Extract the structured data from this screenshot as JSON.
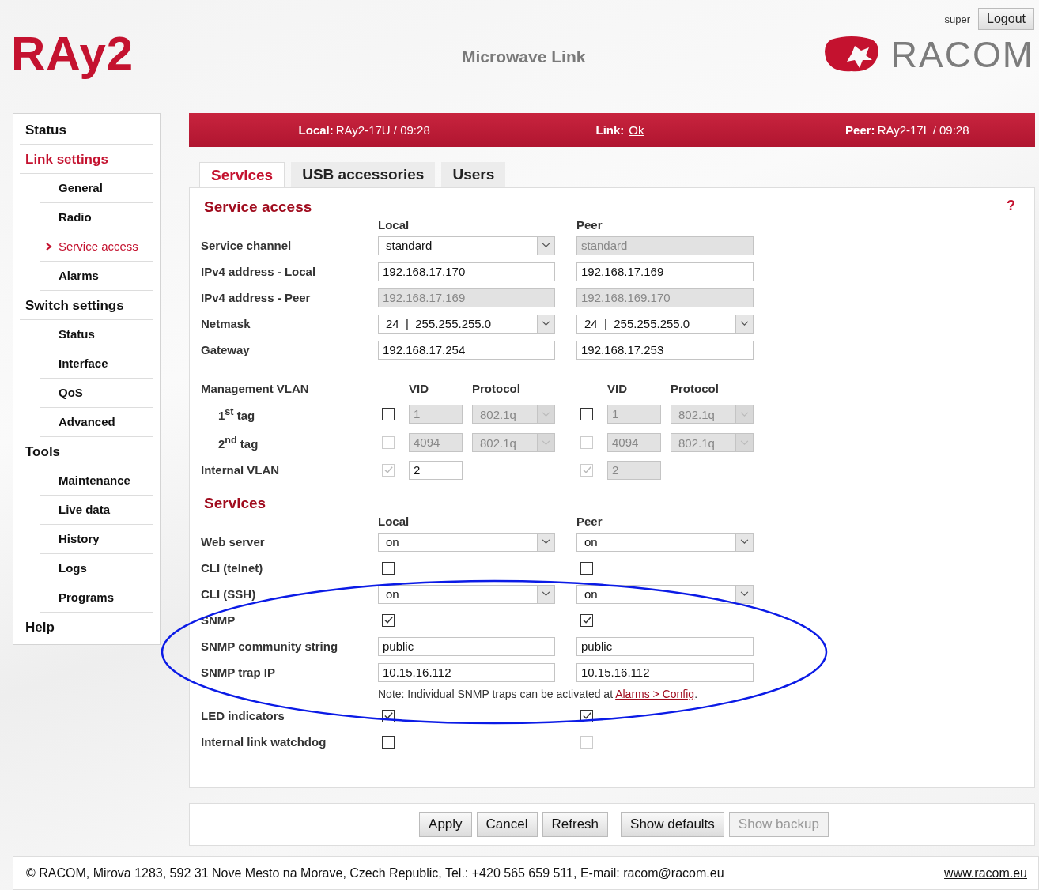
{
  "header": {
    "logo": "RAy2",
    "title": "Microwave Link",
    "brand": "RACOM",
    "user": "super",
    "logout": "Logout"
  },
  "sidebar": [
    {
      "label": "Status",
      "selected": false
    },
    {
      "label": "Link settings",
      "selected": true,
      "children": [
        {
          "label": "General",
          "selected": false
        },
        {
          "label": "Radio",
          "selected": false
        },
        {
          "label": "Service access",
          "selected": true
        },
        {
          "label": "Alarms",
          "selected": false
        }
      ]
    },
    {
      "label": "Switch settings",
      "selected": false,
      "children": [
        {
          "label": "Status",
          "selected": false
        },
        {
          "label": "Interface",
          "selected": false
        },
        {
          "label": "QoS",
          "selected": false
        },
        {
          "label": "Advanced",
          "selected": false
        }
      ]
    },
    {
      "label": "Tools",
      "selected": false,
      "children": [
        {
          "label": "Maintenance",
          "selected": false
        },
        {
          "label": "Live data",
          "selected": false
        },
        {
          "label": "History",
          "selected": false
        },
        {
          "label": "Logs",
          "selected": false
        },
        {
          "label": "Programs",
          "selected": false
        }
      ]
    },
    {
      "label": "Help",
      "selected": false
    }
  ],
  "status_bar": [
    {
      "label": "Local:",
      "value": "RAy2-17U / 09:28",
      "kind": "text"
    },
    {
      "label": "Link:",
      "value": "Ok",
      "kind": "link"
    },
    {
      "label": "Peer:",
      "value": "RAy2-17L / 09:28",
      "kind": "text"
    }
  ],
  "tabs": [
    {
      "label": "Services",
      "selected": true
    },
    {
      "label": "USB accessories",
      "selected": false
    },
    {
      "label": "Users",
      "selected": false
    }
  ],
  "help": "?",
  "sections": [
    {
      "title": "Service access",
      "columns": [
        "Local",
        "Peer"
      ],
      "rows": [
        {
          "kind": "field",
          "label": "Service channel",
          "local": [
            {
              "kind": "select",
              "value": "standard",
              "disabled": false
            }
          ],
          "peer": [
            {
              "kind": "input",
              "value": "standard",
              "disabled": true
            }
          ]
        },
        {
          "kind": "field",
          "label": "IPv4 address - Local",
          "local": [
            {
              "kind": "input",
              "value": "192.168.17.170",
              "disabled": false
            }
          ],
          "peer": [
            {
              "kind": "input",
              "value": "192.168.17.169",
              "disabled": false
            }
          ]
        },
        {
          "kind": "field",
          "label": "IPv4 address - Peer",
          "local": [
            {
              "kind": "input",
              "value": "192.168.17.169",
              "disabled": true
            }
          ],
          "peer": [
            {
              "kind": "input",
              "value": "192.168.169.170",
              "disabled": true
            }
          ]
        },
        {
          "kind": "field",
          "label": "Netmask",
          "local": [
            {
              "kind": "select",
              "value": "24  |  255.255.255.0",
              "disabled": false
            }
          ],
          "peer": [
            {
              "kind": "select",
              "value": "24  |  255.255.255.0",
              "disabled": false
            }
          ]
        },
        {
          "kind": "field",
          "label": "Gateway",
          "local": [
            {
              "kind": "input",
              "value": "192.168.17.254",
              "disabled": false
            }
          ],
          "peer": [
            {
              "kind": "input",
              "value": "192.168.17.253",
              "disabled": false
            }
          ]
        },
        {
          "kind": "header",
          "label": "Management VLAN",
          "local": [
            "VID",
            "Protocol"
          ],
          "peer": [
            "VID",
            "Protocol"
          ]
        },
        {
          "kind": "sub",
          "label": "1$^{st}$ tag",
          "local": [
            {
              "kind": "checkbox",
              "checked": false,
              "disabled": false
            },
            {
              "kind": "vid",
              "value": "1",
              "disabled": true
            },
            {
              "kind": "protocol",
              "value": "802.1q",
              "disabled": true
            }
          ],
          "peer": [
            {
              "kind": "checkbox",
              "checked": false,
              "disabled": false
            },
            {
              "kind": "vid",
              "value": "1",
              "disabled": true
            },
            {
              "kind": "protocol",
              "value": "802.1q",
              "disabled": true
            }
          ]
        },
        {
          "kind": "sub",
          "label": "2$^{nd}$ tag",
          "local": [
            {
              "kind": "checkbox",
              "checked": false,
              "disabled": true
            },
            {
              "kind": "vid",
              "value": "4094",
              "disabled": true
            },
            {
              "kind": "protocol",
              "value": "802.1q",
              "disabled": true
            }
          ],
          "peer": [
            {
              "kind": "checkbox",
              "checked": false,
              "disabled": true
            },
            {
              "kind": "vid",
              "value": "4094",
              "disabled": true
            },
            {
              "kind": "protocol",
              "value": "802.1q",
              "disabled": true
            }
          ]
        },
        {
          "kind": "field",
          "label": "Internal VLAN",
          "local": [
            {
              "kind": "checkbox",
              "checked": true,
              "disabled": true
            },
            {
              "kind": "vid",
              "value": "2",
              "disabled": false
            }
          ],
          "peer": [
            {
              "kind": "checkbox",
              "checked": true,
              "disabled": true
            },
            {
              "kind": "vid",
              "value": "2",
              "disabled": true
            }
          ]
        }
      ]
    },
    {
      "title": "Services",
      "columns": [
        "Local",
        "Peer"
      ],
      "rows": [
        {
          "kind": "field",
          "label": "Web server",
          "local": [
            {
              "kind": "select",
              "value": "on",
              "disabled": false
            }
          ],
          "peer": [
            {
              "kind": "select",
              "value": "on",
              "disabled": false
            }
          ]
        },
        {
          "kind": "field",
          "label": "CLI (telnet)",
          "local": [
            {
              "kind": "checkbox",
              "checked": false,
              "disabled": false
            }
          ],
          "peer": [
            {
              "kind": "checkbox",
              "checked": false,
              "disabled": false
            }
          ]
        },
        {
          "kind": "field",
          "label": "CLI (SSH)",
          "local": [
            {
              "kind": "select",
              "value": "on",
              "disabled": false
            }
          ],
          "peer": [
            {
              "kind": "select",
              "value": "on",
              "disabled": false
            }
          ]
        },
        {
          "kind": "field",
          "label": "SNMP",
          "local": [
            {
              "kind": "checkbox",
              "checked": true,
              "disabled": false
            }
          ],
          "peer": [
            {
              "kind": "checkbox",
              "checked": true,
              "disabled": false
            }
          ]
        },
        {
          "kind": "field",
          "label": "SNMP community string",
          "local": [
            {
              "kind": "input",
              "value": "public",
              "disabled": false
            }
          ],
          "peer": [
            {
              "kind": "input",
              "value": "public",
              "disabled": false
            }
          ]
        },
        {
          "kind": "field",
          "label": "SNMP trap IP",
          "local": [
            {
              "kind": "input",
              "value": "10.15.16.112",
              "disabled": false
            }
          ],
          "peer": [
            {
              "kind": "input",
              "value": "10.15.16.112",
              "disabled": false
            }
          ]
        },
        {
          "kind": "note",
          "text": "Note: Individual SNMP traps can be activated at ",
          "link": "Alarms > Config",
          "after": "."
        },
        {
          "kind": "field",
          "label": "LED indicators",
          "local": [
            {
              "kind": "checkbox",
              "checked": true,
              "disabled": false
            }
          ],
          "peer": [
            {
              "kind": "checkbox",
              "checked": true,
              "disabled": false
            }
          ]
        },
        {
          "kind": "field",
          "label": "Internal link watchdog",
          "local": [
            {
              "kind": "checkbox",
              "checked": false,
              "disabled": false
            }
          ],
          "peer": [
            {
              "kind": "checkbox",
              "checked": false,
              "disabled": true
            }
          ]
        }
      ]
    }
  ],
  "button_groups": [
    [
      {
        "label": "Apply",
        "disabled": false
      },
      {
        "label": "Cancel",
        "disabled": false
      },
      {
        "label": "Refresh",
        "disabled": false
      }
    ],
    [
      {
        "label": "Show defaults",
        "disabled": false
      },
      {
        "label": "Show backup",
        "disabled": true
      }
    ]
  ],
  "footer": {
    "text": "© RACOM, Mirova 1283, 592 31 Nove Mesto na Morave, Czech Republic, Tel.: +420 565 659 511, E-mail: racom@racom.eu",
    "link": "www.racom.eu"
  }
}
